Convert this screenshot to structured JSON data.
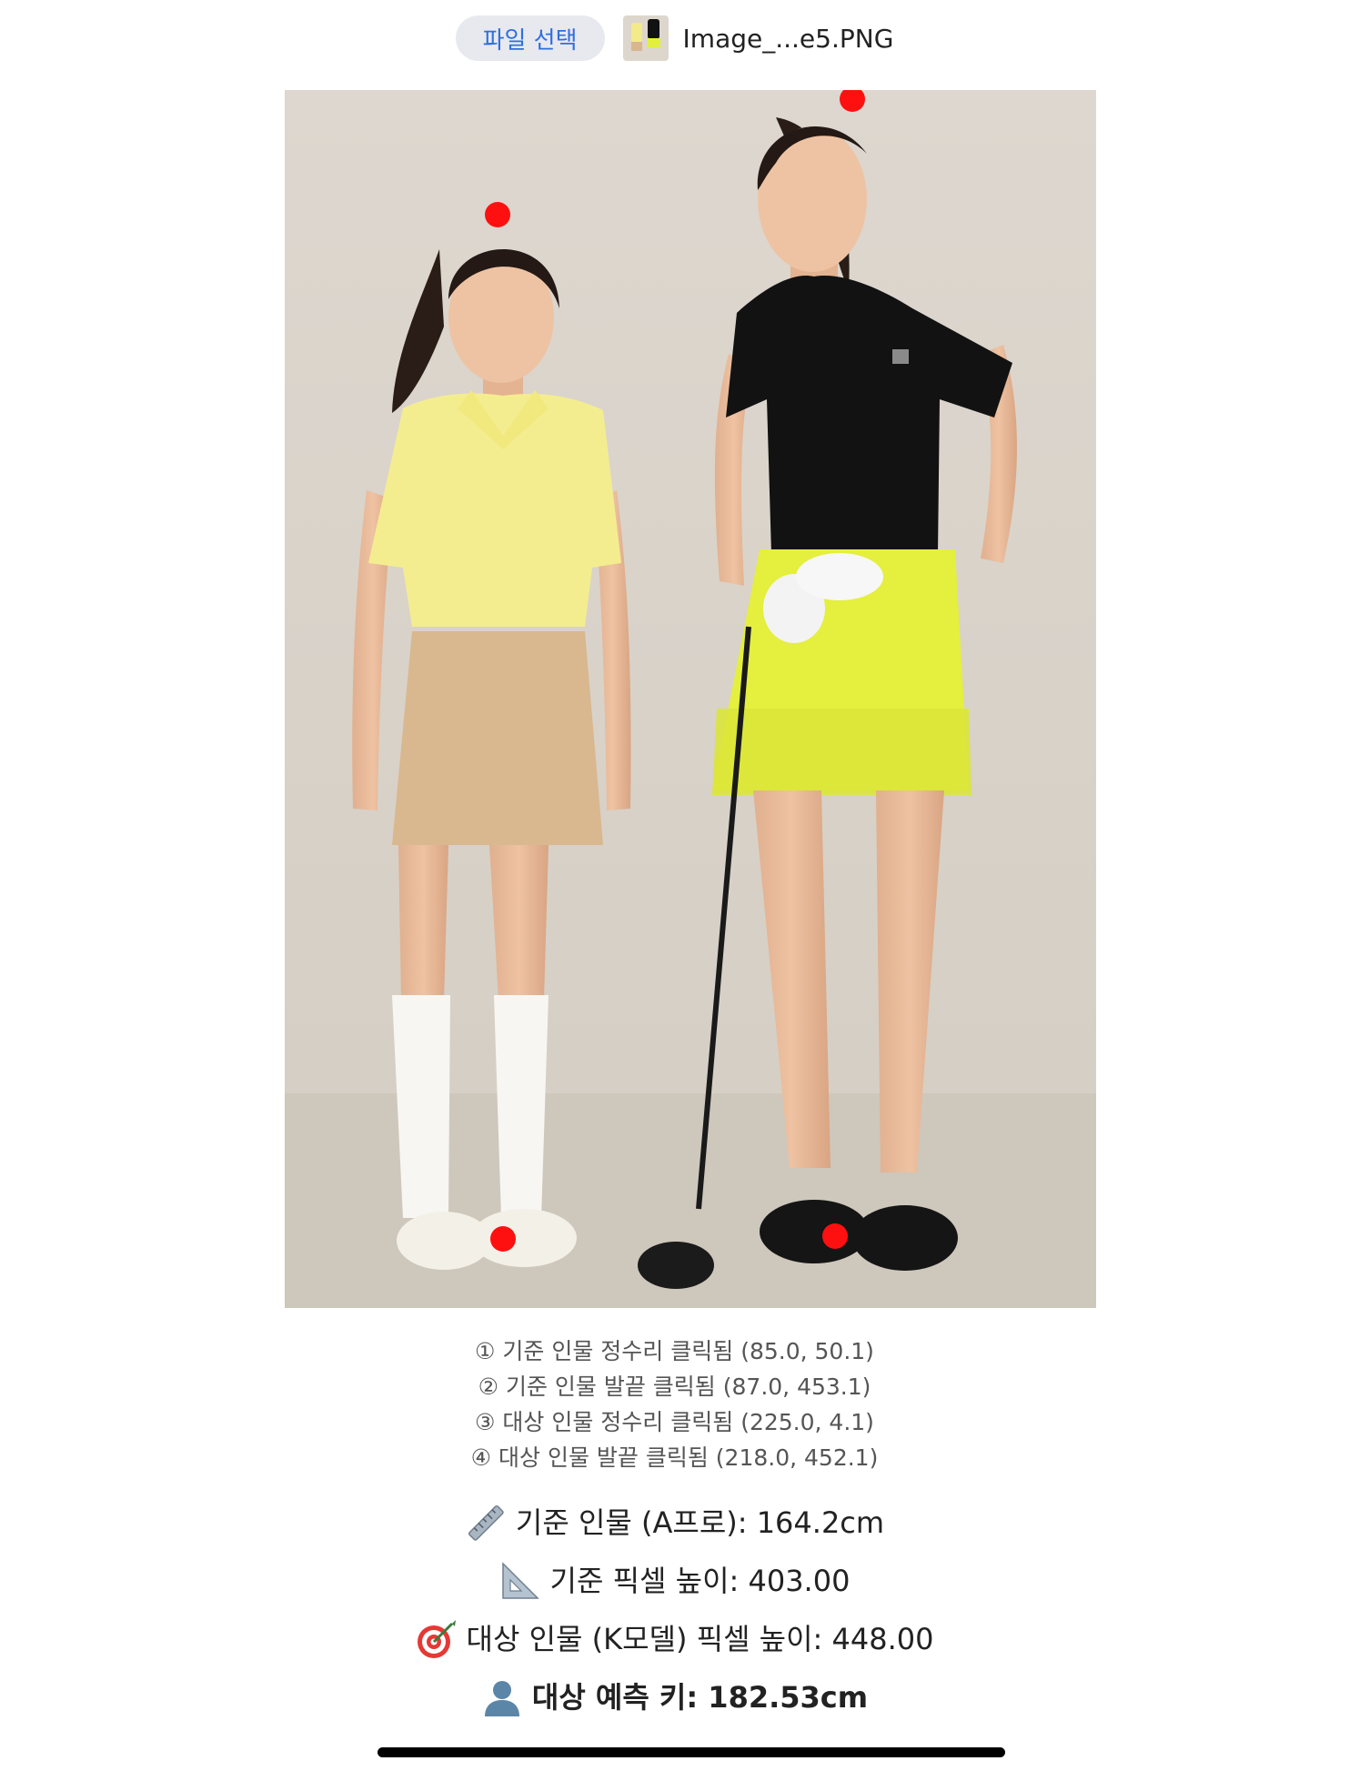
{
  "file_picker": {
    "button_label": "파일 선택",
    "file_name": "Image_...e5.PNG"
  },
  "photo": {
    "markers": [
      {
        "name": "reference-head-marker",
        "label": "①"
      },
      {
        "name": "reference-foot-marker",
        "label": "②"
      },
      {
        "name": "target-head-marker",
        "label": "③"
      },
      {
        "name": "target-foot-marker",
        "label": "④"
      }
    ]
  },
  "click_log": [
    "① 기준 인물 정수리 클릭됨 (85.0, 50.1)",
    "② 기준 인물 발끝 클릭됨 (87.0, 453.1)",
    "③ 대상 인물 정수리 클릭됨 (225.0, 4.1)",
    "④ 대상 인물 발끝 클릭됨 (218.0, 452.1)"
  ],
  "results": {
    "reference_height": {
      "icon": "ruler-icon",
      "text": "기준 인물 (A프로): 164.2cm"
    },
    "reference_pixels": {
      "icon": "triangle-ruler-icon",
      "text": "기준 픽셀 높이: 403.00"
    },
    "target_pixels": {
      "icon": "dart-target-icon",
      "text": "대상 인물 (K모델) 픽셀 높이: 448.00"
    },
    "predicted_height": {
      "icon": "person-silhouette-icon",
      "text": "대상 예측 키: 182.53cm"
    }
  },
  "colors": {
    "button_bg": "#e7e9ee",
    "button_text": "#2f6fe0",
    "marker": "#ff1010",
    "wall": "#dcd6cd",
    "floor": "#cfc8be"
  }
}
